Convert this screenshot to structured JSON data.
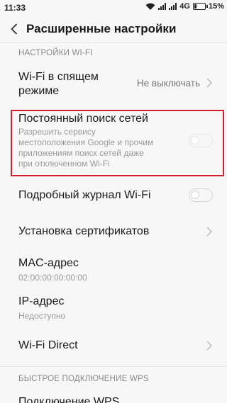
{
  "status": {
    "time": "11:33",
    "network": "4G",
    "battery": "15%"
  },
  "header": {
    "title": "Расширенные настройки"
  },
  "sections": {
    "wifi": "НАСТРОЙКИ WI-FI",
    "wps": "БЫСТРОЕ ПОДКЛЮЧЕНИЕ WPS"
  },
  "items": {
    "sleep": {
      "title_line1": "Wi-Fi в спящем",
      "title_line2": "режиме",
      "value": "Не выключать"
    },
    "scan": {
      "title": "Постоянный поиск сетей",
      "sub1": "Разрешить сервису",
      "sub2": "местоположения Google и прочим",
      "sub3": "приложениям поиск сетей даже",
      "sub4": "при отключенном Wi-Fi",
      "enabled": false
    },
    "log": {
      "title": "Подробный журнал Wi-Fi",
      "enabled": false
    },
    "certs": {
      "title": "Установка сертификатов"
    },
    "mac": {
      "title": "MAC-адрес",
      "value": "02:00:00:00:00:00"
    },
    "ip": {
      "title": "IP-адрес",
      "value": "Недоступно"
    },
    "direct": {
      "title": "Wi-Fi Direct"
    },
    "wps_button": {
      "title": "Подключение WPS"
    }
  },
  "colors": {
    "highlight": "#d0202b",
    "background": "#f7f7f7"
  }
}
